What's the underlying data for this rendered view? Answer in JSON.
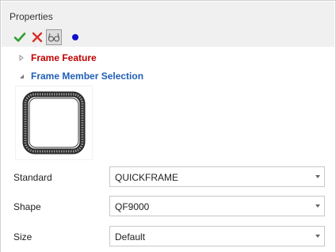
{
  "panel": {
    "title": "Properties"
  },
  "toolbar": {
    "ok_icon": "checkmark-icon",
    "cancel_icon": "close-icon",
    "preview_icon": "glasses-icon",
    "status_icon": "blue-dot-icon",
    "colors": {
      "ok": "#2e9e2e",
      "cancel": "#d6312b",
      "dot": "#1010c8"
    }
  },
  "sections": {
    "frame_feature": {
      "label": "Frame Feature",
      "expanded": false,
      "color": "#c00000"
    },
    "frame_member_selection": {
      "label": "Frame Member Selection",
      "expanded": true,
      "color": "#1f5fb8"
    }
  },
  "fields": {
    "standard": {
      "label": "Standard",
      "value": "QUICKFRAME"
    },
    "shape": {
      "label": "Shape",
      "value": "QF9000"
    },
    "size": {
      "label": "Size",
      "value": "Default"
    }
  }
}
